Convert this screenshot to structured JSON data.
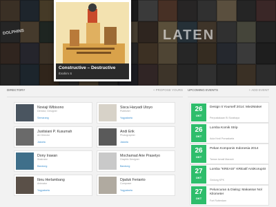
{
  "hero": {
    "feature_title": "Constructive – Destructive",
    "feature_author": "Ibrahim S",
    "bg_text_1": "LATEN",
    "bg_text_2": "DOLPHINS"
  },
  "directory": {
    "title": "DIRECTORY",
    "action": "+ PROPOSE YOURS",
    "people": [
      {
        "name": "Noviaji Wibisono",
        "role": "Director, Designer",
        "city": "Semarang"
      },
      {
        "name": "Sisca Haryadi Utoyo",
        "role": "Publisher",
        "city": "Yogyakarta"
      },
      {
        "name": "Justisiani P. Kusumah",
        "role": "Art Director",
        "city": "Jakarta"
      },
      {
        "name": "Andi Erik",
        "role": "Photographer",
        "city": "Jakarta"
      },
      {
        "name": "Dony Irawan",
        "role": "Illustrator",
        "city": "Bandung"
      },
      {
        "name": "Mochamad Arie Prasetyo",
        "role": "Graphic Designer",
        "city": "Bandung"
      },
      {
        "name": "Ibnu Herlambang",
        "role": "Animator",
        "city": "Yogyakarta"
      },
      {
        "name": "Djaduk Ferianto",
        "role": "Composer",
        "city": "Yogyakarta"
      }
    ]
  },
  "events": {
    "title": "UPCOMING EVENTS",
    "action": "+ ADD EVENT",
    "items": [
      {
        "day": "26",
        "month": "OKT",
        "title": "Design It Yourself 2014: Mie2Make!",
        "venue": "Perpustakaan BI Surabaya"
      },
      {
        "day": "26",
        "month": "OKT",
        "title": "Lomba Komik Strip",
        "venue": "Aula Kecil Purwakarta"
      },
      {
        "day": "26",
        "month": "OKT",
        "title": "Pekan Komponis Indonesia 2014",
        "venue": "Taman Ismail Marzuki"
      },
      {
        "day": "27",
        "month": "OKT",
        "title": "Lomba \"KREASI\" KREatif AntiKorupSI",
        "venue": "Gedung KPK"
      },
      {
        "day": "27",
        "month": "OKT",
        "title": "Peluncuran & Dialog: Makassar Nol Kilometer",
        "venue": "Fort Rotterdam"
      }
    ]
  },
  "colors": {
    "accent_green": "#2ebd6b",
    "link_blue": "#3b8fcf"
  }
}
